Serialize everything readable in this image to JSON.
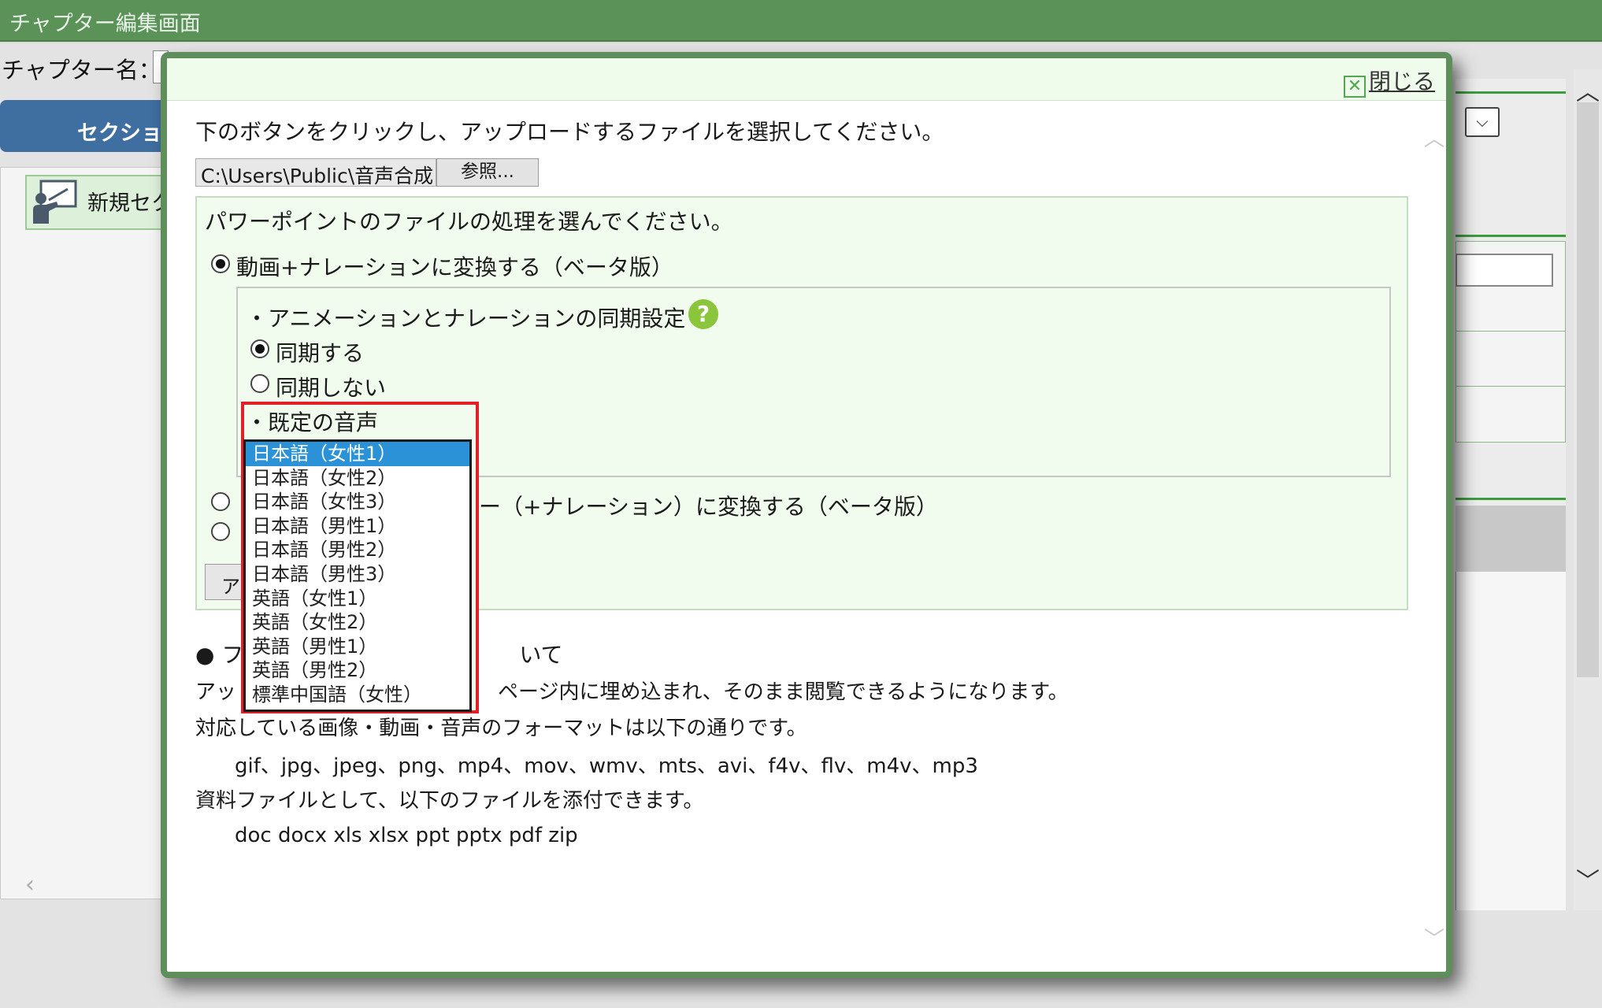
{
  "app": {
    "title": "チャプター編集画面"
  },
  "background": {
    "chapter_name_label": "チャプター名：",
    "section_button": "セクション",
    "new_section_label": "新規セク"
  },
  "modal": {
    "close_label": "閉じる",
    "instruction": "下のボタンをクリックし、アップロードするファイルを選択してください。",
    "file_path": "C:\\Users\\Public\\音声合成",
    "browse_label": "参照...",
    "options_heading": "パワーポイントのファイルの処理を選んでください。",
    "option_video_label": "動画+ナレーションに変換する（ベータ版）",
    "sync_heading": "・アニメーションとナレーションの同期設定",
    "help_icon": "?",
    "sync_on_label": "同期する",
    "sync_off_label": "同期しない",
    "default_voice_label": "・既定の音声",
    "option2_label_visible": "ー（+ナレーション）に変換する（ベータ版）",
    "upload_button_label": "ア",
    "about_heading": "● フ",
    "about_heading_tail": "いて",
    "desc_1_head": "アッ",
    "desc_1_tail": "ページ内に埋め込まれ、そのまま閲覧できるようになります。",
    "desc_2": "対応している画像・動画・音声のフォーマットは以下の通りです。",
    "formats": "gif、jpg、jpeg、png、mp4、mov、wmv、mts、avi、f4v、flv、m4v、mp3",
    "desc_3": "資料ファイルとして、以下のファイルを添付できます。",
    "attach_formats": "doc docx xls xlsx ppt pptx pdf zip"
  },
  "voice_options": [
    "日本語（女性1）",
    "日本語（女性2）",
    "日本語（女性3）",
    "日本語（男性1）",
    "日本語（男性2）",
    "日本語（男性3）",
    "英語（女性1）",
    "英語（女性2）",
    "英語（男性1）",
    "英語（男性2）",
    "標準中国語（女性）"
  ],
  "voice_selected": "日本語（女性1）",
  "icons": {
    "close": "close-x-icon",
    "help": "help-question-icon",
    "presenter": "presenter-icon",
    "scroll_up": "chevron-up-icon",
    "scroll_down": "chevron-down-icon"
  },
  "colors": {
    "topbar": "#5a9258",
    "modal_border": "#5f8d5c",
    "highlight": "#e0212a",
    "selection": "#2b92d8",
    "section_button": "#3f6ea0",
    "help_icon": "#8ac53c"
  }
}
